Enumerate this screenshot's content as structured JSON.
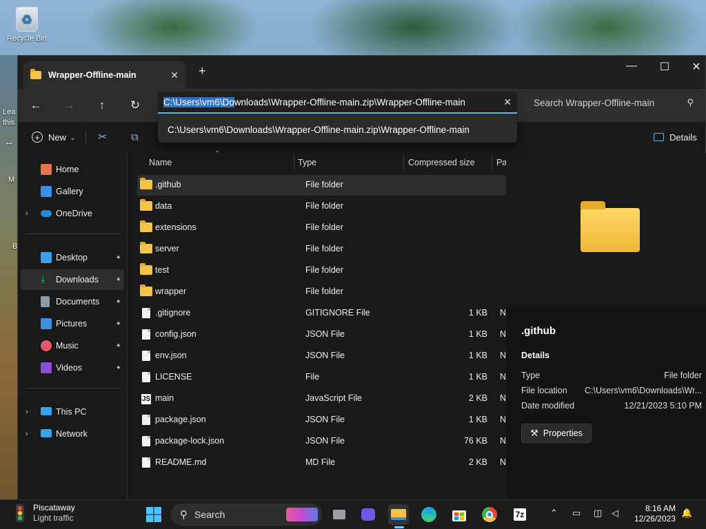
{
  "desktop": {
    "recycle_bin": "Recycle Bin",
    "fragments": [
      "Lea",
      "this",
      "M",
      "B"
    ]
  },
  "window": {
    "tab_title": "Wrapper-Offline-main",
    "tab_close": "✕",
    "new_tab": "+",
    "minimize": "—",
    "maximize": "☐",
    "close": "✕"
  },
  "nav": {
    "back": "←",
    "forward": "→",
    "up": "↑",
    "refresh": "↻",
    "address_selected": "C:\\Users\\vm6\\Do",
    "address_rest": "wnloads\\Wrapper-Offline-main.zip\\Wrapper-Offline-main",
    "address_clear": "✕",
    "suggestion": "C:\\Users\\vm6\\Downloads\\Wrapper-Offline-main.zip\\Wrapper-Offline-main",
    "search_placeholder": "Search Wrapper-Offline-main",
    "search_icon": "⚲"
  },
  "toolbar": {
    "new_label": "New",
    "new_chevron": "⌄",
    "cut_icon": "✂",
    "copy_icon": "⧉",
    "details_label": "Details"
  },
  "sidebar": {
    "items": [
      {
        "label": "Home",
        "icon": "home-icon",
        "color": "#e8734a"
      },
      {
        "label": "Gallery",
        "icon": "gallery-icon",
        "color": "#3a8ee6"
      },
      {
        "label": "OneDrive",
        "icon": "onedrive-icon",
        "color": "#2b88d8",
        "chev": "›"
      },
      {
        "label": "Desktop",
        "icon": "desktop-icon",
        "color": "#38a3e8",
        "pin": "📌"
      },
      {
        "label": "Downloads",
        "icon": "downloads-icon",
        "color": "#2fb36b",
        "pin": "📌"
      },
      {
        "label": "Documents",
        "icon": "documents-icon",
        "color": "#8a9bb0",
        "pin": "📌"
      },
      {
        "label": "Pictures",
        "icon": "pictures-icon",
        "color": "#3a8ee6",
        "pin": "📌"
      },
      {
        "label": "Music",
        "icon": "music-icon",
        "color": "#e8566a",
        "pin": "📌"
      },
      {
        "label": "Videos",
        "icon": "videos-icon",
        "color": "#8a4fd8",
        "pin": "📌"
      },
      {
        "label": "This PC",
        "icon": "this-pc-icon",
        "color": "#38a3e8",
        "chev": "›"
      },
      {
        "label": "Network",
        "icon": "network-icon",
        "color": "#38a3e8",
        "chev": "›"
      }
    ]
  },
  "columns": {
    "name": "Name",
    "type": "Type",
    "compressed": "Compressed size",
    "ratio": "Pa",
    "sort_icon": "⌃"
  },
  "files": [
    {
      "name": ".github",
      "type": "File folder",
      "size": "",
      "ratio": "",
      "kind": "folder"
    },
    {
      "name": "data",
      "type": "File folder",
      "size": "",
      "ratio": "",
      "kind": "folder"
    },
    {
      "name": "extensions",
      "type": "File folder",
      "size": "",
      "ratio": "",
      "kind": "folder"
    },
    {
      "name": "server",
      "type": "File folder",
      "size": "",
      "ratio": "",
      "kind": "folder"
    },
    {
      "name": "test",
      "type": "File folder",
      "size": "",
      "ratio": "",
      "kind": "folder"
    },
    {
      "name": "wrapper",
      "type": "File folder",
      "size": "",
      "ratio": "",
      "kind": "folder"
    },
    {
      "name": ".gitignore",
      "type": "GITIGNORE File",
      "size": "1 KB",
      "ratio": "No",
      "kind": "file"
    },
    {
      "name": "config.json",
      "type": "JSON File",
      "size": "1 KB",
      "ratio": "No",
      "kind": "file"
    },
    {
      "name": "env.json",
      "type": "JSON File",
      "size": "1 KB",
      "ratio": "No",
      "kind": "file"
    },
    {
      "name": "LICENSE",
      "type": "File",
      "size": "1 KB",
      "ratio": "No",
      "kind": "file"
    },
    {
      "name": "main",
      "type": "JavaScript File",
      "size": "2 KB",
      "ratio": "No",
      "kind": "js"
    },
    {
      "name": "package.json",
      "type": "JSON File",
      "size": "1 KB",
      "ratio": "No",
      "kind": "file"
    },
    {
      "name": "package-lock.json",
      "type": "JSON File",
      "size": "76 KB",
      "ratio": "No",
      "kind": "file"
    },
    {
      "name": "README.md",
      "type": "MD File",
      "size": "2 KB",
      "ratio": "No",
      "kind": "file"
    }
  ],
  "details": {
    "title": ".github",
    "section": "Details",
    "type_label": "Type",
    "type_value": "File folder",
    "location_label": "File location",
    "location_value": "C:\\Users\\vm6\\Downloads\\Wr...",
    "modified_label": "Date modified",
    "modified_value": "12/21/2023 5:10 PM",
    "properties_label": "Properties",
    "properties_icon": "🔧"
  },
  "taskbar": {
    "weather_city": "Piscataway",
    "weather_status": "Light traffic",
    "search_label": "Search",
    "tray_chevron": "⌃",
    "time": "8:16 AM",
    "date": "12/26/2023",
    "sevenzip_label": "7z"
  }
}
